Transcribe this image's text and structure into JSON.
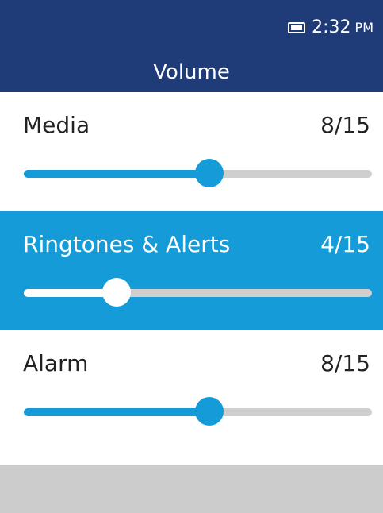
{
  "status_bar": {
    "time": "2:32",
    "ampm": "PM",
    "background": "#1f3b78"
  },
  "header": {
    "title": "Volume"
  },
  "rows": [
    {
      "label": "Media",
      "value_text": "8/15",
      "level": 0.533,
      "focused": false
    },
    {
      "label": "Ringtones & Alerts",
      "value_text": "4/15",
      "level": 0.267,
      "focused": true
    },
    {
      "label": "Alarm",
      "value_text": "8/15",
      "level": 0.533,
      "focused": false
    }
  ],
  "colors": {
    "accent": "#159bd7",
    "track": "#cfcfcf",
    "text": "#222222"
  }
}
